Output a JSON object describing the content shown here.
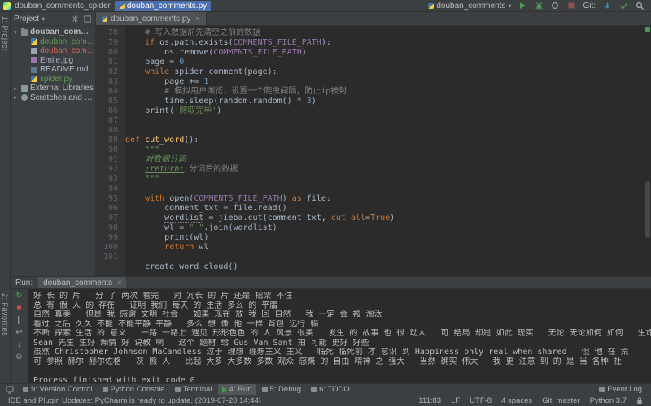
{
  "window": {
    "title": "douban_comments_spider"
  },
  "ui": {
    "chevron_down": "▾",
    "close": "×"
  },
  "navbar": {
    "project_crumb": "douban_comments_spider",
    "file_crumb": "douban_comments.py",
    "run_config": "douban_comments",
    "git_label": "Git:"
  },
  "stripe": {
    "top": "1: Project",
    "bottom": "2: Favorites"
  },
  "project_panel": {
    "title": "Project",
    "tree": [
      {
        "label": "douban_comments_spider",
        "level": 0,
        "icon": "folder",
        "arrow": "▾",
        "color": "#bbbbbb",
        "bold": true
      },
      {
        "label": "douban_comments.py",
        "level": 1,
        "icon": "python",
        "color": "#629755"
      },
      {
        "label": "douban_comments.txt",
        "level": 1,
        "icon": "text",
        "color": "#d1675a"
      },
      {
        "label": "Emile.jpg",
        "level": 1,
        "icon": "image",
        "color": "#a9b7c6"
      },
      {
        "label": "README.md",
        "level": 1,
        "icon": "markdown",
        "color": "#a9b7c6"
      },
      {
        "label": "spider.py",
        "level": 1,
        "icon": "python",
        "color": "#629755"
      },
      {
        "label": "External Libraries",
        "level": 0,
        "icon": "libraries",
        "arrow": "▸",
        "color": "#bbbbbb"
      },
      {
        "label": "Scratches and Consoles",
        "level": 0,
        "icon": "scratches",
        "arrow": "▸",
        "color": "#bbbbbb"
      }
    ]
  },
  "editor": {
    "tab_label": "douban_comments.py",
    "default_color": "#a9b7c6",
    "token_colors": {
      "k": "#cc7832",
      "s": "#6a8759",
      "c": "#808080",
      "n": "#6897bb",
      "f": "#ffc66b",
      "d": "#629755",
      "dt": "#629755",
      "ct": "#9876aa",
      "kw": "#b3774d",
      "u": "#a9b7c6"
    },
    "lines": [
      {
        "n": 78,
        "segs": [
          [
            "    ",
            ""
          ],
          [
            "# 写入数据前先清空之前的数据",
            "c"
          ]
        ]
      },
      {
        "n": 79,
        "segs": [
          [
            "    ",
            ""
          ],
          [
            "if",
            "k"
          ],
          [
            " os.path.exists(",
            ""
          ],
          [
            "COMMENTS_FILE_PATH",
            "ct"
          ],
          [
            "):",
            ""
          ]
        ]
      },
      {
        "n": 80,
        "segs": [
          [
            "        os.remove(",
            ""
          ],
          [
            "COMMENTS_FILE_PATH",
            "ct"
          ],
          [
            ")",
            ""
          ]
        ]
      },
      {
        "n": 81,
        "segs": [
          [
            "    page = ",
            ""
          ],
          [
            "0",
            "n"
          ]
        ]
      },
      {
        "n": 82,
        "segs": [
          [
            "    ",
            ""
          ],
          [
            "while",
            "k"
          ],
          [
            " spider_comment(page):",
            ""
          ]
        ]
      },
      {
        "n": 83,
        "segs": [
          [
            "        page += ",
            ""
          ],
          [
            "1",
            "n"
          ]
        ]
      },
      {
        "n": 84,
        "segs": [
          [
            "        ",
            ""
          ],
          [
            "# 模拟用户浏览，设置一个爬虫间隔，防止ip被封",
            "c"
          ]
        ]
      },
      {
        "n": 85,
        "segs": [
          [
            "        time.sleep(random.random() * ",
            ""
          ],
          [
            "3",
            "n"
          ],
          [
            ")",
            ""
          ]
        ]
      },
      {
        "n": 86,
        "segs": [
          [
            "    print(",
            ""
          ],
          [
            "'爬取完毕'",
            "s"
          ],
          [
            ")",
            ""
          ]
        ]
      },
      {
        "n": 87,
        "segs": []
      },
      {
        "n": 88,
        "segs": []
      },
      {
        "n": 89,
        "segs": [
          [
            "def",
            "k"
          ],
          [
            " ",
            ""
          ],
          [
            "cut_word",
            "f"
          ],
          [
            "():",
            ""
          ]
        ]
      },
      {
        "n": 90,
        "segs": [
          [
            "    ",
            ""
          ],
          [
            "\"\"\"",
            "d"
          ]
        ]
      },
      {
        "n": 91,
        "segs": [
          [
            "    ",
            ""
          ],
          [
            "对数据分词",
            "d"
          ]
        ]
      },
      {
        "n": 92,
        "segs": [
          [
            "    ",
            ""
          ],
          [
            ":return:",
            "dt"
          ],
          [
            " ",
            ""
          ],
          [
            "分词后的数据",
            "c"
          ]
        ]
      },
      {
        "n": 93,
        "segs": [
          [
            "    ",
            ""
          ],
          [
            "\"\"\"",
            "d"
          ]
        ]
      },
      {
        "n": 94,
        "segs": []
      },
      {
        "n": 95,
        "segs": [
          [
            "    ",
            ""
          ],
          [
            "with",
            "k"
          ],
          [
            " open(",
            ""
          ],
          [
            "COMMENTS_FILE_PATH",
            "ct"
          ],
          [
            ") ",
            ""
          ],
          [
            "as",
            "k"
          ],
          [
            " file:",
            ""
          ]
        ]
      },
      {
        "n": 96,
        "segs": [
          [
            "        comment_txt = file.read()",
            ""
          ]
        ]
      },
      {
        "n": 97,
        "segs": [
          [
            "        ",
            ""
          ],
          [
            "wordlist",
            "u"
          ],
          [
            " = jieba.cut(comment_txt, ",
            ""
          ],
          [
            "cut_all",
            "kw"
          ],
          [
            "=",
            ""
          ],
          [
            "True",
            "k"
          ],
          [
            ")",
            ""
          ]
        ]
      },
      {
        "n": 98,
        "segs": [
          [
            "        wl = ",
            ""
          ],
          [
            "\" \"",
            "s"
          ],
          [
            ".join(wordlist)",
            ""
          ]
        ]
      },
      {
        "n": 99,
        "segs": [
          [
            "        print(wl)",
            ""
          ]
        ]
      },
      {
        "n": 100,
        "segs": [
          [
            "        ",
            ""
          ],
          [
            "return",
            "k"
          ],
          [
            " wl",
            ""
          ]
        ]
      },
      {
        "n": 101,
        "segs": []
      }
    ],
    "partial_line": "    create_word_cloud()"
  },
  "run_panel": {
    "label": "Run:",
    "tab_label": "douban_comments",
    "toolbar": [
      {
        "name": "rerun-button",
        "glyph": "↻",
        "color": "#499C54"
      },
      {
        "name": "stop-button",
        "glyph": "■",
        "color": "#C75450"
      },
      {
        "name": "pause-output-button",
        "glyph": "∥",
        "color": "#9da0a3"
      },
      {
        "name": "soft-wrap-button",
        "glyph": "↩",
        "color": "#9da0a3"
      },
      {
        "name": "scroll-to-end-button",
        "glyph": "↓",
        "color": "#9da0a3"
      },
      {
        "name": "clear-output-button",
        "glyph": "⊘",
        "color": "#9da0a3"
      }
    ],
    "console": [
      "好 长 的 片   分 了 两次 看完   对 冗长 的 片 还是 招架 不住",
      "总 有 假 人 的 存在   证明 我们 每天 的 生活 多么 的 平庸",
      "自然 真美   但是 我 感谢 文明 社会   如果 现在 放 我 回 自然   我 一定 会 被 淘汰",
      "看过 之后 久久 不能 不能平静 平静   多么 想 像 他 一样 背包 远行 躺",
      "不断 探索 生活 的 意义   一路 一路上 遇见 形形色色 的 人 风景 很美   发生 的 故事 也 很 动人   可 结局 却是 如此 现实   无论 无论如何 如何   生命 确实",
      "Sean 先生 生好 煽情 好 说教 啊   这个 题材 给 Gus Van Sant 拍 可能 更好 好些",
      "虽然 Christopher Johnson MaCandless 过于 理想 理想主义 主义   临死 临死前 才 意识 到 Happiness only real when shared   但 他 在 荒",
      "可 参照 赫尔 赫尔佐格   灰 熊 人   比起 大多 大多数 多数 观众 感慨 的 自由 精神 之 强大   当然 确实 伟大   我 更 注意 到 的 是 当 各种 社",
      "",
      "Process finished with exit code 0"
    ]
  },
  "toolbuttons": {
    "left": [
      {
        "name": "tool-button-version-control",
        "label": "9: Version Control",
        "icon": "vcs"
      },
      {
        "name": "tool-button-python-console",
        "label": "Python Console",
        "icon": "console"
      },
      {
        "name": "tool-button-terminal",
        "label": "Terminal",
        "icon": "terminal"
      },
      {
        "name": "tool-button-run",
        "label": "4: Run",
        "icon": "run",
        "active": true
      },
      {
        "name": "tool-button-debug",
        "label": "5: Debug",
        "icon": "debug"
      },
      {
        "name": "tool-button-todo",
        "label": "6: TODO",
        "icon": "todo"
      }
    ],
    "right": [
      {
        "name": "tool-button-event-log",
        "label": "Event Log",
        "icon": "event"
      }
    ]
  },
  "statusbar": {
    "message": "IDE and Plugin Updates: PyCharm is ready to update. (2019-07-20 14:44)",
    "segments": [
      {
        "name": "caret-position",
        "label": "111:83"
      },
      {
        "name": "line-separator",
        "label": "LF"
      },
      {
        "name": "file-encoding",
        "label": "UTF-8"
      },
      {
        "name": "indent-setting",
        "label": "4 spaces"
      },
      {
        "name": "git-branch",
        "label": "Git: master"
      },
      {
        "name": "python-interpreter",
        "label": "Python 3.7"
      }
    ]
  }
}
